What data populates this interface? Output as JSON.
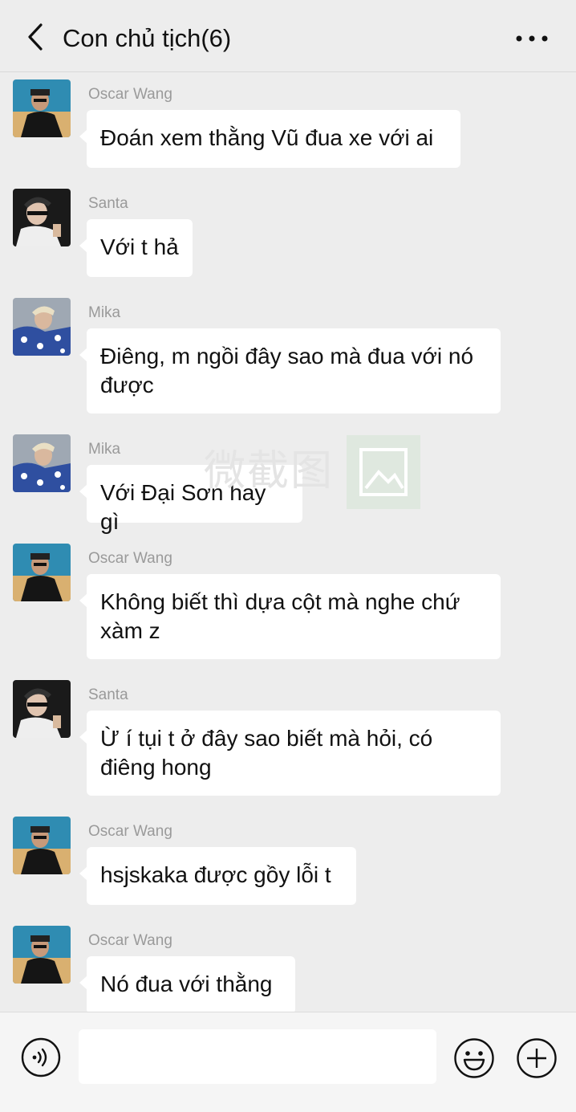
{
  "header": {
    "title": "Con chủ tịch(6)",
    "back_icon": "chevron-left-icon",
    "more_icon": "more-dots-icon"
  },
  "messages": [
    {
      "sender": "Oscar Wang",
      "avatar": "avatar-oscar",
      "lines": [
        "Đoán xem thằng Vũ đua xe với ai"
      ]
    },
    {
      "sender": "Santa",
      "avatar": "avatar-santa",
      "lines": [
        "Với t hả"
      ]
    },
    {
      "sender": "Mika",
      "avatar": "avatar-mika",
      "lines": [
        "Điêng, m ngồi đây sao mà đua với nó",
        "được"
      ]
    },
    {
      "sender": "Mika",
      "avatar": "avatar-mika",
      "lines": [
        "Với Đại Sơn hay gì"
      ]
    },
    {
      "sender": "Oscar Wang",
      "avatar": "avatar-oscar",
      "lines": [
        "Không biết thì dựa cột mà nghe chứ",
        "xàm z"
      ]
    },
    {
      "sender": "Santa",
      "avatar": "avatar-santa",
      "lines": [
        "Ừ í tụi t ở đây sao biết mà hỏi, có",
        "điêng hong"
      ]
    },
    {
      "sender": "Oscar Wang",
      "avatar": "avatar-oscar",
      "lines": [
        "hsjskaka được gồy lỗi t"
      ]
    },
    {
      "sender": "Oscar Wang",
      "avatar": "avatar-oscar",
      "lines": [
        "Nó đua với thằng"
      ]
    }
  ],
  "watermark": {
    "text": "微截图"
  },
  "input_bar": {
    "message_value": "",
    "voice_icon": "voice-icon",
    "emoji_icon": "emoji-icon",
    "plus_icon": "plus-icon"
  },
  "colors": {
    "background": "#ededed",
    "bubble": "#ffffff",
    "sender_name": "#9a9a9a"
  }
}
